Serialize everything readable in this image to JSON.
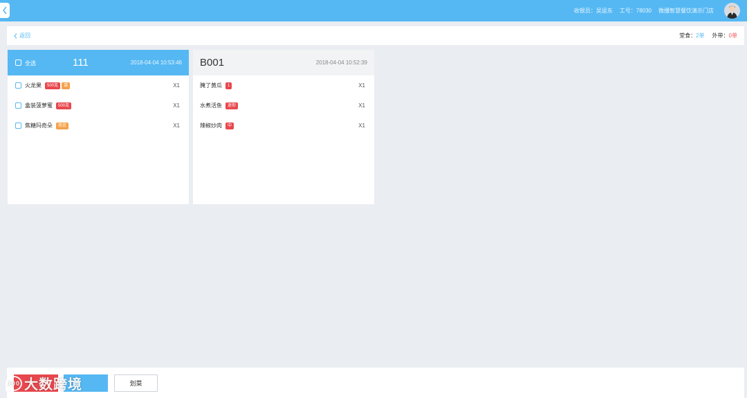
{
  "topbar": {
    "cashier_label": "收银员：吴运东",
    "staff_no_label": "工号：78030",
    "store_name": "微播智慧餐饮演示门店"
  },
  "subbar": {
    "back_label": "返回",
    "dine_in_label": "堂食：",
    "dine_in_count": "2单",
    "takeaway_label": "外带：",
    "takeaway_count": "0单"
  },
  "orders": [
    {
      "select_all_label": "全选",
      "table_no": "111",
      "time": "2018-04-04 10:53:46",
      "dishes": [
        {
          "name": "火龙果",
          "tags": [
            "500克",
            "苗"
          ],
          "qty": "X1"
        },
        {
          "name": "盒装菠萝蜜",
          "tags": [
            "500克"
          ],
          "qty": "X1"
        },
        {
          "name": "焦糖玛奇朵",
          "tags": [
            "热饮"
          ],
          "qty": "X1"
        }
      ]
    },
    {
      "table_no": "B001",
      "time": "2018-04-04 10:52:39",
      "dishes": [
        {
          "name": "腌了黄瓜",
          "tags": [
            "1"
          ],
          "qty": "X1"
        },
        {
          "name": "水煮活鱼",
          "tags": [
            "迷你"
          ],
          "qty": "X1"
        },
        {
          "name": "辣椒炒肉",
          "tags": [
            "中"
          ],
          "qty": "X1"
        }
      ]
    }
  ],
  "bottombar": {
    "mark_label": "划菜"
  },
  "watermark": {
    "mark_text": "100",
    "text": "大数跨境"
  },
  "colors": {
    "primary": "#55b8f3",
    "danger": "#e8474d",
    "warning": "#f5a14a",
    "background": "#eaedf1"
  }
}
